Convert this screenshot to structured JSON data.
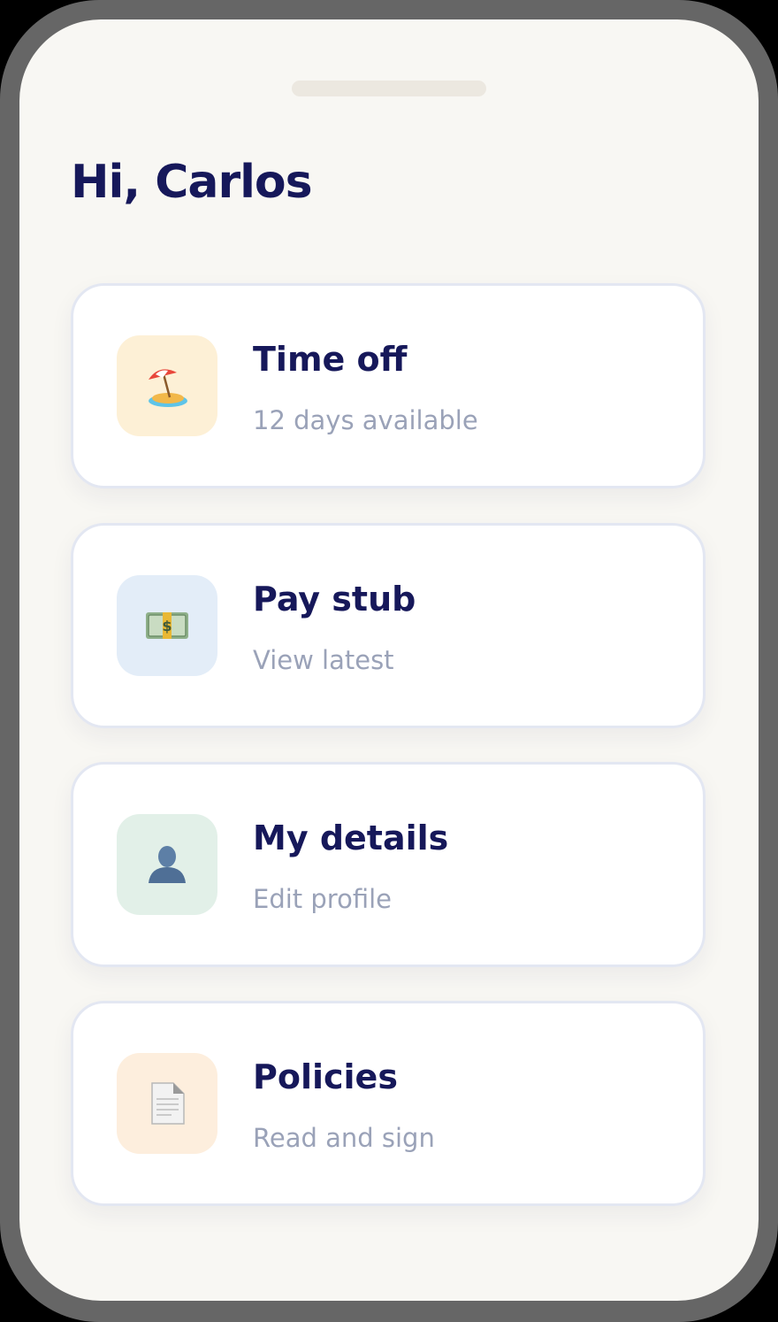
{
  "greeting": "Hi, Carlos",
  "cards": [
    {
      "title": "Time off",
      "subtitle": "12 days available",
      "icon": "beach-umbrella-icon",
      "tile_color": "#fdf0d6"
    },
    {
      "title": "Pay stub",
      "subtitle": "View latest",
      "icon": "dollar-banknote-icon",
      "tile_color": "#e3edf8"
    },
    {
      "title": "My details",
      "subtitle": "Edit profile",
      "icon": "person-silhouette-icon",
      "tile_color": "#e2f0e8"
    },
    {
      "title": "Policies",
      "subtitle": "Read and sign",
      "icon": "document-icon",
      "tile_color": "#fdeedd"
    }
  ],
  "colors": {
    "frame": "#666666",
    "screen": "#f8f7f3",
    "heading": "#16185a",
    "muted": "#9aa2b8",
    "card_border": "#e3e7f2"
  }
}
